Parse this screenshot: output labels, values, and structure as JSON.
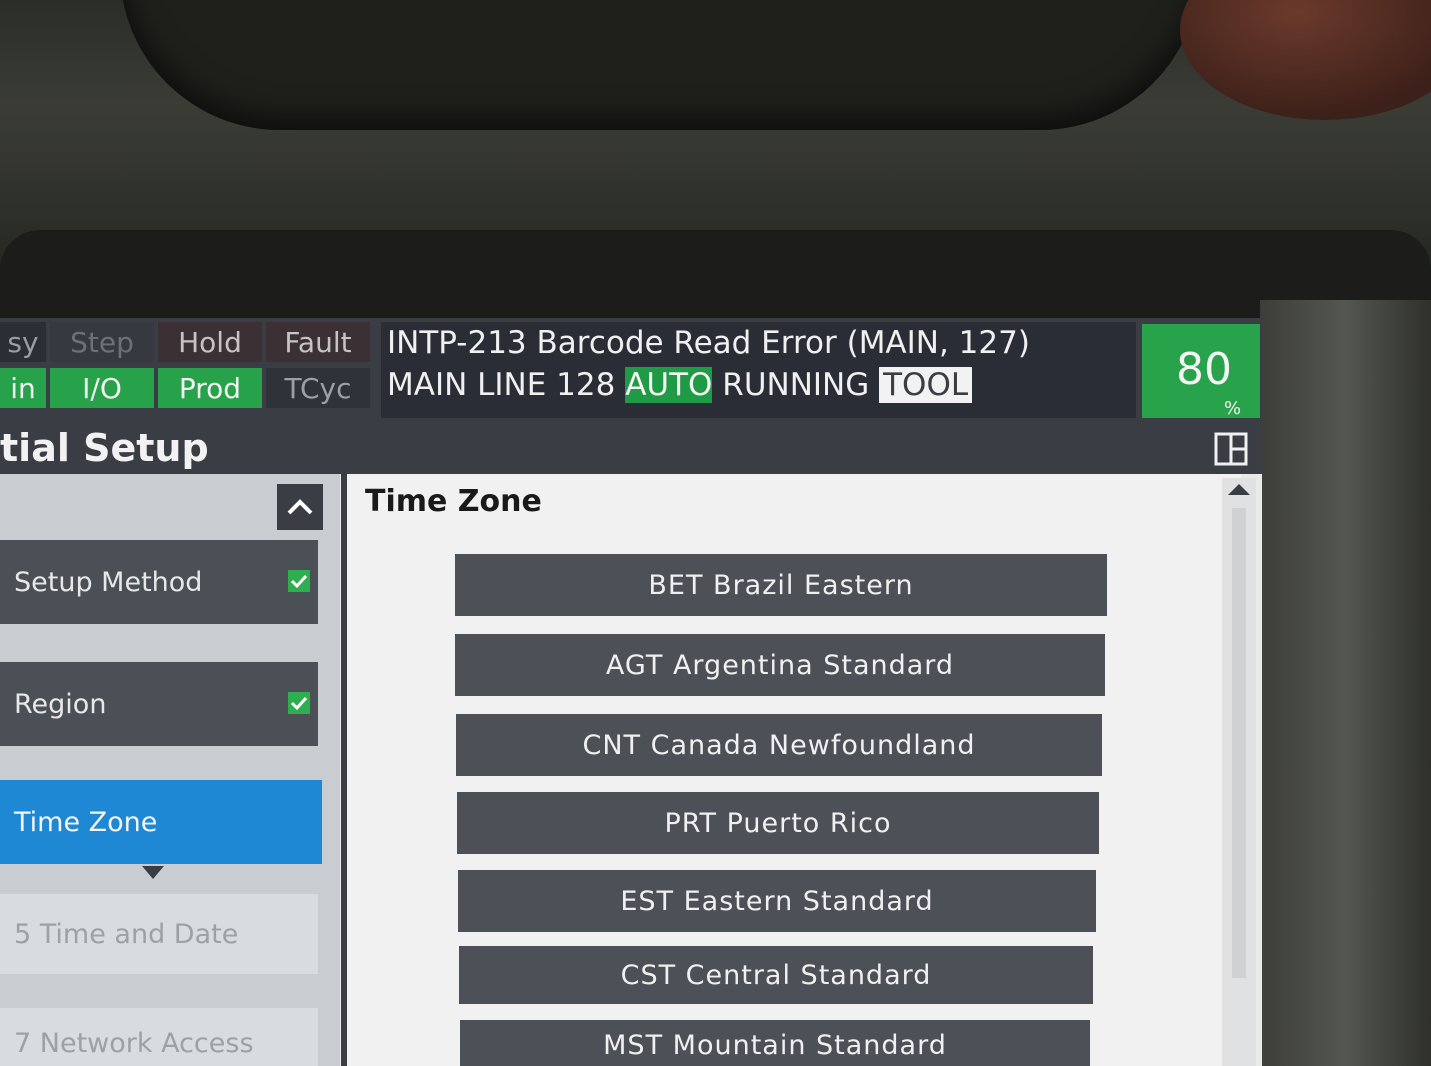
{
  "status": {
    "buttons_row1": [
      "sy",
      "Step",
      "Hold",
      "Fault"
    ],
    "buttons_row2": [
      "in",
      "I/O",
      "Prod",
      "TCyc"
    ]
  },
  "alarm": {
    "line1": "INTP-213 Barcode Read Error (MAIN, 127)",
    "line2_prefix": "MAIN LINE 128 ",
    "line2_mode": "AUTO",
    "line2_state": " RUNNING ",
    "line2_tool": "TOOL"
  },
  "override": {
    "value": "80",
    "unit": "%"
  },
  "title": "tial Setup",
  "steps": [
    {
      "label": "Setup Method",
      "completed": true
    },
    {
      "label": "Region",
      "completed": true
    },
    {
      "label": "Time Zone",
      "completed": false
    },
    {
      "label": "5  Time and Date",
      "completed": false
    },
    {
      "label": "7  Network Access",
      "completed": false
    }
  ],
  "content": {
    "section_title": "Time Zone",
    "timezones": [
      "BET Brazil Eastern",
      "AGT Argentina Standard",
      "CNT Canada Newfoundland",
      "PRT Puerto Rico",
      "EST Eastern Standard",
      "CST Central Standard",
      "MST Mountain Standard"
    ]
  },
  "colors": {
    "active_step": "#1e88d4",
    "ok_green": "#27a24a",
    "panel_dark": "#3a3d44",
    "tz_button": "#4e5058"
  }
}
